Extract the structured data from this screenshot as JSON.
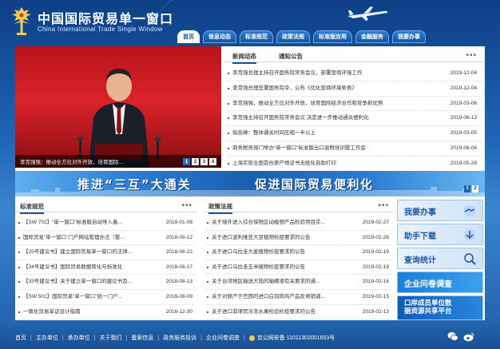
{
  "header": {
    "title": "中国国际贸易单一窗口",
    "subtitle": "China International Trade Single Window"
  },
  "nav": [
    {
      "label": "首页",
      "active": true
    },
    {
      "label": "信息动态"
    },
    {
      "label": "标准规范"
    },
    {
      "label": "政策法规"
    },
    {
      "label": "标准版应用"
    },
    {
      "label": "金融服务"
    },
    {
      "label": "我要办事"
    }
  ],
  "slider": {
    "caption": "李克强强：推动全方位对外开放，培育国际…",
    "pages": [
      "1",
      "2",
      "3",
      "4"
    ]
  },
  "news": {
    "tabs": [
      "新闻动态",
      "通知公告"
    ],
    "more": "•••",
    "items": [
      {
        "title": "李克强总理主持召开国务院常务会议，部署营商环境工作",
        "date": "2019-12-04"
      },
      {
        "title": "李克强总理签署国务院令，公布《优化营商环境条例》",
        "date": "2019-12-04"
      },
      {
        "title": "李克强强，推动全方位对外开放，培育国际经济合作和竞争新优势",
        "date": "2019-03-06"
      },
      {
        "title": "李克强主持召开国务院常务会议 决定进一步推动通关便利化",
        "date": "2019-06-13"
      },
      {
        "title": "倪岳峰：整体通关时间压缩一半以上",
        "date": "2019-03-05"
      },
      {
        "title": "商务税务部门举办“单一窗口”标准版出口退税培训暨工作会",
        "date": "2019-06-04"
      },
      {
        "title": "上海实现全国首份原产地证书无纸化自助打印",
        "date": "2019-05-28"
      }
    ]
  },
  "banner": {
    "left": "推进“三互”大通关",
    "right": "促进国际贸易便利化",
    "pages": [
      "1",
      "2"
    ]
  },
  "standards": {
    "title": "标准规范",
    "more": "•••",
    "items": [
      {
        "title": "【SW 702】“单一窗口”标准版自动导入着...",
        "date": "2019-01-08"
      },
      {
        "title": "国际贸易“单一窗口”门户网站管理办法（暂...",
        "date": "2018-09-12"
      },
      {
        "title": "【25号建议书】建立国际贸易单一窗口的法律...",
        "date": "2018-08-22"
      },
      {
        "title": "【34号建议书】国际贸易数据简化与标准化",
        "date": "2018-08-17"
      },
      {
        "title": "【33号建议书】关于建立单一窗口的建议书及...",
        "date": "2018-08-13"
      },
      {
        "title": "【SW 501】国际贸易“单一窗口”统一门户...",
        "date": "2018-08-09"
      },
      {
        "title": "一致化贸易单证设计指南",
        "date": "2016-12-30"
      }
    ]
  },
  "policies": {
    "title": "政策法规",
    "more": "•••",
    "items": [
      {
        "title": "关于境外进入综合保税区动植物产品检验项目实...",
        "date": "2019-02-27"
      },
      {
        "title": "关于进口波利维亚大豆植物检疫要求的公告",
        "date": "2019-02-26"
      },
      {
        "title": "关于进口乌拉圭大麦植物检疫要求的公告",
        "date": "2019-02-19"
      },
      {
        "title": "关于进口乌拉圭玉米植物检疫要求的公告",
        "date": "2019-02-19"
      },
      {
        "title": "关于台湾地区输送大陆的输精液有关要求的通...",
        "date": "2019-02-16"
      },
      {
        "title": "关于对原产于巴西的进口白羽肉鸡产品反倾销调...",
        "date": "2019-02-15"
      },
      {
        "title": "关于进口菲律宾冷冻水果检验检疫要求的公告",
        "date": "2019-02-13"
      }
    ]
  },
  "side_buttons": [
    {
      "label": "我要办事"
    },
    {
      "label": "助手下载"
    },
    {
      "label": "查询统计"
    },
    {
      "label": "企业问卷调查"
    },
    {
      "label_line1": "口岸成员单位数",
      "label_line2": "据资源共享平台"
    }
  ],
  "footer": {
    "links": [
      "首页",
      "主办单位",
      "承办单位",
      "关于我们",
      "备案信息",
      "政务服务投诉",
      "企业问卷调查"
    ],
    "police": "京公网安备 11011302001653号"
  }
}
